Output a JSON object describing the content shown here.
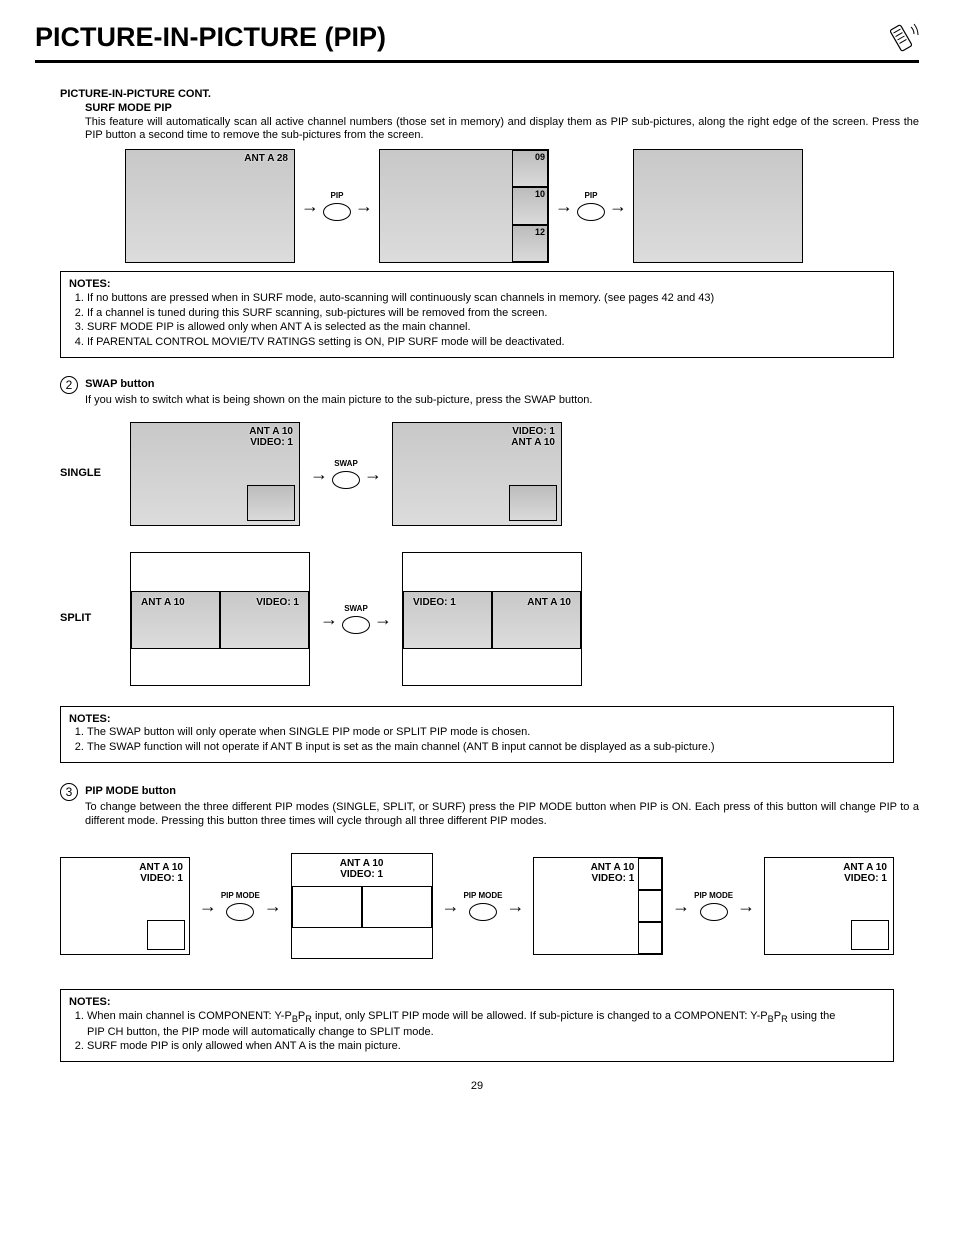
{
  "header": {
    "title": "PICTURE-IN-PICTURE (PIP)"
  },
  "cont_heading": "PICTURE-IN-PICTURE CONT.",
  "surf": {
    "heading": "SURF MODE PIP",
    "text": "This feature will automatically scan all active channel numbers (those set in memory) and display them as PIP sub-pictures, along the right edge of the screen.  Press the PIP button a second time to remove the sub-pictures from the screen.",
    "label_ant": "ANT A   28",
    "btn": "PIP",
    "ch": {
      "a": "09",
      "b": "10",
      "c": "12"
    },
    "notes_label": "NOTES:",
    "notes": [
      "If no buttons are pressed when in SURF mode, auto-scanning will continuously scan channels in memory.  (see pages 42 and 43)",
      "If a channel is tuned during this SURF scanning, sub-pictures will be removed from the screen.",
      "SURF MODE PIP is allowed only when ANT A is selected as the main channel.",
      "If PARENTAL CONTROL MOVIE/TV RATINGS setting is ON, PIP SURF mode will be deactivated."
    ]
  },
  "swap": {
    "num": "2",
    "title": "SWAP button",
    "text": "If you wish to switch what is being shown on the main picture to the sub-picture, press the SWAP button.",
    "btn": "SWAP",
    "single_label": "SINGLE",
    "split_label": "SPLIT",
    "ant": "ANT A 10",
    "vid": "VIDEO: 1",
    "vid_alt": "VIDEO: 1",
    "ant_alt": "ANT  A 10",
    "notes_label": "NOTES:",
    "notes": [
      "The SWAP button will only operate when SINGLE PIP mode or SPLIT PIP mode is chosen.",
      "The SWAP function will not operate if ANT B input is set as the main channel (ANT B input cannot be displayed as a sub-picture.)"
    ]
  },
  "pipmode": {
    "num": "3",
    "title": "PIP MODE button",
    "text": "To change between the three different PIP modes (SINGLE, SPLIT, or SURF) press the PIP MODE button when PIP is ON.  Each press of this button will change PIP to a different mode.  Pressing this button three times will cycle through all three different PIP modes.",
    "btn": "PIP MODE",
    "ant": "ANT A 10",
    "vid": "VIDEO: 1",
    "notes_label": "NOTES:",
    "note1_a": "When main channel is COMPONENT: Y-P",
    "note1_b": "B",
    "note1_c": "P",
    "note1_d": "R",
    "note1_e": " input, only SPLIT PIP mode will be allowed.  If sub-picture is changed to a COMPONENT: Y-P",
    "note1_f": "B",
    "note1_g": "P",
    "note1_h": "R",
    "note1_i": " using the PIP CH button, the PIP mode will automatically change to SPLIT mode.",
    "note2": "SURF mode PIP is only allowed when ANT A is the main picture."
  },
  "page": "29"
}
